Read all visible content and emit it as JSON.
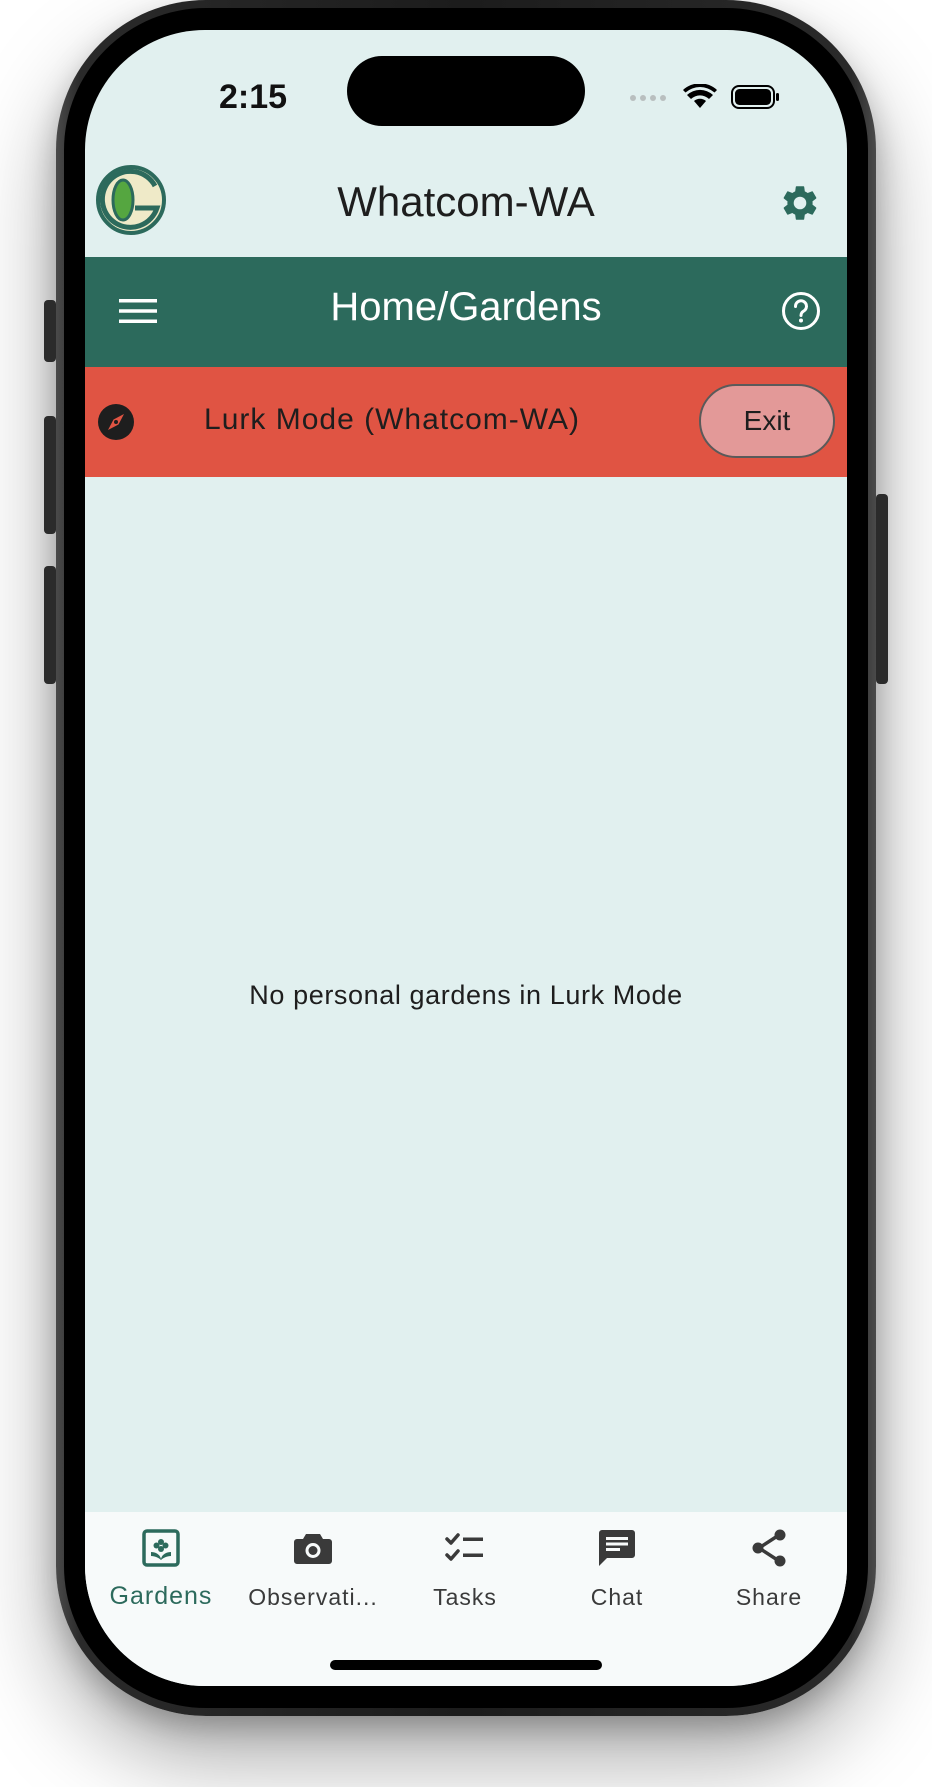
{
  "status_bar": {
    "time": "2:15"
  },
  "header": {
    "title": "Whatcom-WA"
  },
  "nav_bar": {
    "title": "Home/Gardens"
  },
  "lurk_banner": {
    "text": "Lurk Mode (Whatcom-WA)",
    "exit_label": "Exit"
  },
  "main": {
    "empty_message": "No personal gardens in Lurk Mode"
  },
  "bottom_nav": {
    "tabs": [
      {
        "label": "Gardens",
        "icon": "garden-icon",
        "active": true
      },
      {
        "label": "Observati...",
        "icon": "camera-icon",
        "active": false
      },
      {
        "label": "Tasks",
        "icon": "checklist-icon",
        "active": false
      },
      {
        "label": "Chat",
        "icon": "chat-icon",
        "active": false
      },
      {
        "label": "Share",
        "icon": "share-icon",
        "active": false
      }
    ]
  },
  "colors": {
    "primary": "#2c6a5c",
    "lurk_banner": "#e05443",
    "exit_button": "#e39998",
    "background": "#e1f0ef"
  }
}
